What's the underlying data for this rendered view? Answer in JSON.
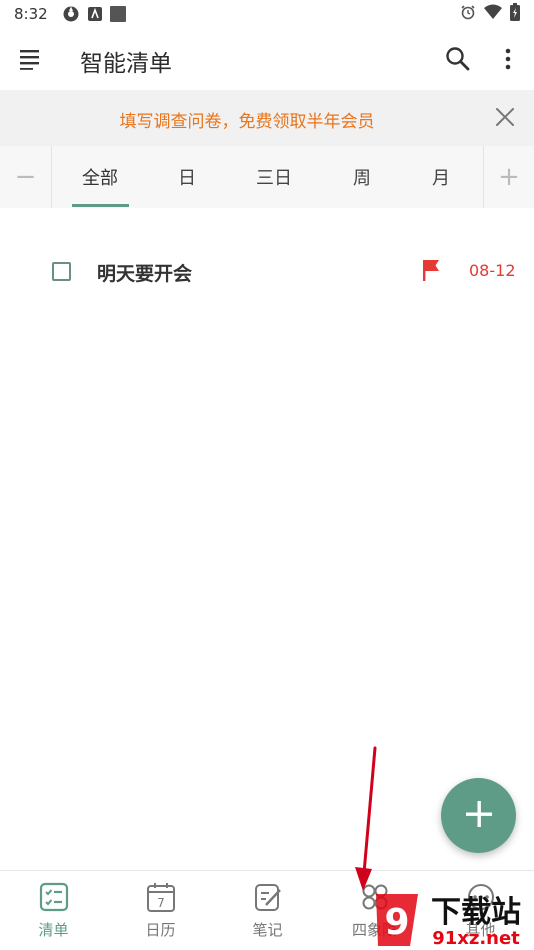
{
  "status_bar": {
    "time": "8:32"
  },
  "app_bar": {
    "title": "智能清单"
  },
  "banner": {
    "text": "填写调查问卷，免费领取半年会员"
  },
  "tabs": {
    "items": [
      "全部",
      "日",
      "三日",
      "周",
      "月"
    ],
    "active": "全部",
    "minus_label": "−",
    "plus_label": "+"
  },
  "tasks": [
    {
      "title": "明天要开会",
      "date": "08-12",
      "flag_color": "#e53935",
      "done": false
    }
  ],
  "bottom_nav": {
    "items": [
      {
        "label": "清单",
        "icon": "checklist-icon",
        "active": true
      },
      {
        "label": "日历",
        "icon": "calendar-icon",
        "calendar_day": "7"
      },
      {
        "label": "笔记",
        "icon": "note-icon"
      },
      {
        "label": "四象限",
        "icon": "quadrant-icon"
      },
      {
        "label": "其他",
        "icon": "other-icon"
      }
    ]
  },
  "colors": {
    "accent": "#5e9c88",
    "banner_text": "#e8741c",
    "flag": "#e53935",
    "annotation_arrow": "#d0021b"
  },
  "watermark": {
    "text_top": "下载站",
    "text_bottom": "91xz.net",
    "logo_digit": "9"
  }
}
